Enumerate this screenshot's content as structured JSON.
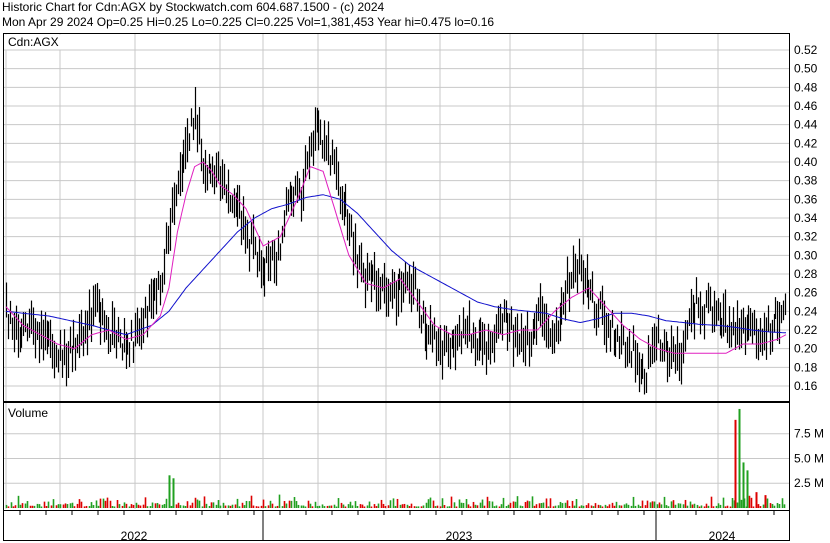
{
  "header": {
    "line1": "Historic Chart for Cdn:AGX by Stockwatch.com 604.687.1500 - (c) 2024",
    "line2": "Mon Apr 29 2024   Op=0.25  Hi=0.25  Lo=0.225  Cl=0.225  Vol=1,381,453  Year hi=0.475  lo=0.16"
  },
  "chart_data": [
    {
      "type": "line",
      "panel_label": "Cdn:AGX",
      "y_ticks": [
        "0.52",
        "0.50",
        "0.48",
        "0.46",
        "0.44",
        "0.42",
        "0.40",
        "0.38",
        "0.36",
        "0.34",
        "0.32",
        "0.30",
        "0.28",
        "0.26",
        "0.24",
        "0.22",
        "0.20",
        "0.18",
        "0.16"
      ],
      "ylim": [
        0.145,
        0.535
      ],
      "x_labels": [
        "2022",
        "2023",
        "2024"
      ],
      "grid": true,
      "colors": {
        "price_bars": "#000000",
        "ma_short": "#e020c0",
        "ma_long": "#1010cc",
        "grid": "#c8c8c8"
      },
      "price_path": {
        "x_week": [
          0,
          3,
          6,
          9,
          12,
          15,
          18,
          21,
          24,
          27,
          30,
          33,
          36,
          38,
          40,
          42,
          44,
          46,
          48,
          50,
          52,
          54,
          57,
          60,
          63,
          66,
          69,
          72,
          75,
          77,
          79,
          81,
          83,
          86,
          89,
          92,
          95,
          98,
          101,
          104,
          107,
          110,
          113,
          116,
          119,
          122,
          125,
          128,
          131,
          134,
          137,
          140,
          143,
          146,
          149,
          152,
          155,
          158,
          161,
          164,
          167,
          170,
          173,
          176,
          179,
          182
        ],
        "close": [
          0.24,
          0.21,
          0.23,
          0.21,
          0.19,
          0.2,
          0.22,
          0.25,
          0.22,
          0.2,
          0.21,
          0.24,
          0.27,
          0.33,
          0.39,
          0.41,
          0.45,
          0.4,
          0.39,
          0.38,
          0.37,
          0.35,
          0.31,
          0.29,
          0.3,
          0.36,
          0.37,
          0.44,
          0.42,
          0.38,
          0.36,
          0.31,
          0.28,
          0.27,
          0.25,
          0.27,
          0.27,
          0.22,
          0.2,
          0.21,
          0.22,
          0.21,
          0.19,
          0.24,
          0.21,
          0.21,
          0.24,
          0.21,
          0.27,
          0.29,
          0.25,
          0.23,
          0.21,
          0.2,
          0.17,
          0.21,
          0.19,
          0.2,
          0.25,
          0.24,
          0.23,
          0.22,
          0.22,
          0.21,
          0.23,
          0.24
        ]
      },
      "ma_short": {
        "x_week": [
          0,
          4,
          8,
          12,
          16,
          20,
          24,
          28,
          32,
          36,
          38,
          40,
          42,
          44,
          46,
          48,
          50,
          53,
          56,
          60,
          64,
          68,
          71,
          74,
          77,
          80,
          84,
          88,
          92,
          96,
          100,
          104,
          108,
          112,
          116,
          120,
          124,
          128,
          132,
          136,
          140,
          144,
          148,
          152,
          156,
          160,
          164,
          168,
          172,
          176,
          180,
          182
        ],
        "values": [
          0.245,
          0.225,
          0.215,
          0.205,
          0.2,
          0.215,
          0.22,
          0.21,
          0.215,
          0.235,
          0.265,
          0.325,
          0.365,
          0.395,
          0.4,
          0.39,
          0.375,
          0.365,
          0.35,
          0.31,
          0.32,
          0.36,
          0.395,
          0.39,
          0.345,
          0.3,
          0.27,
          0.265,
          0.275,
          0.25,
          0.225,
          0.215,
          0.215,
          0.22,
          0.215,
          0.22,
          0.22,
          0.24,
          0.255,
          0.265,
          0.245,
          0.225,
          0.21,
          0.2,
          0.195,
          0.195,
          0.195,
          0.195,
          0.205,
          0.205,
          0.21,
          0.215
        ]
      },
      "ma_long": {
        "x_week": [
          0,
          10,
          20,
          28,
          34,
          38,
          42,
          46,
          50,
          54,
          58,
          62,
          66,
          70,
          74,
          78,
          82,
          86,
          90,
          94,
          98,
          102,
          106,
          110,
          114,
          118,
          122,
          126,
          130,
          134,
          138,
          142,
          146,
          150,
          154,
          158,
          162,
          166,
          170,
          174,
          178,
          182
        ],
        "values": [
          0.24,
          0.235,
          0.225,
          0.215,
          0.225,
          0.24,
          0.265,
          0.285,
          0.305,
          0.325,
          0.34,
          0.35,
          0.355,
          0.362,
          0.365,
          0.36,
          0.345,
          0.325,
          0.305,
          0.29,
          0.28,
          0.27,
          0.26,
          0.25,
          0.245,
          0.242,
          0.24,
          0.238,
          0.232,
          0.228,
          0.232,
          0.238,
          0.238,
          0.235,
          0.23,
          0.228,
          0.226,
          0.225,
          0.223,
          0.22,
          0.218,
          0.217
        ]
      }
    },
    {
      "type": "bar",
      "panel_label": "Volume",
      "y_ticks": [
        "7.5 M",
        "5.0 M",
        "2.5 M"
      ],
      "ylim": [
        0,
        10.5
      ],
      "unit": "millions",
      "colors": {
        "up": "#20a020",
        "down": "#dd0000"
      },
      "notable_bars": [
        {
          "x_week": 38,
          "value": 3.3,
          "dir": "up"
        },
        {
          "x_week": 39,
          "value": 3.0,
          "dir": "up"
        },
        {
          "x_week": 170,
          "value": 8.9,
          "dir": "down"
        },
        {
          "x_week": 171,
          "value": 10.0,
          "dir": "up"
        },
        {
          "x_week": 172,
          "value": 4.6,
          "dir": "up"
        },
        {
          "x_week": 173,
          "value": 3.8,
          "dir": "up"
        },
        {
          "x_week": 175,
          "value": 1.6,
          "dir": "down"
        },
        {
          "x_week": 177,
          "value": 1.3,
          "dir": "down"
        }
      ]
    }
  ]
}
